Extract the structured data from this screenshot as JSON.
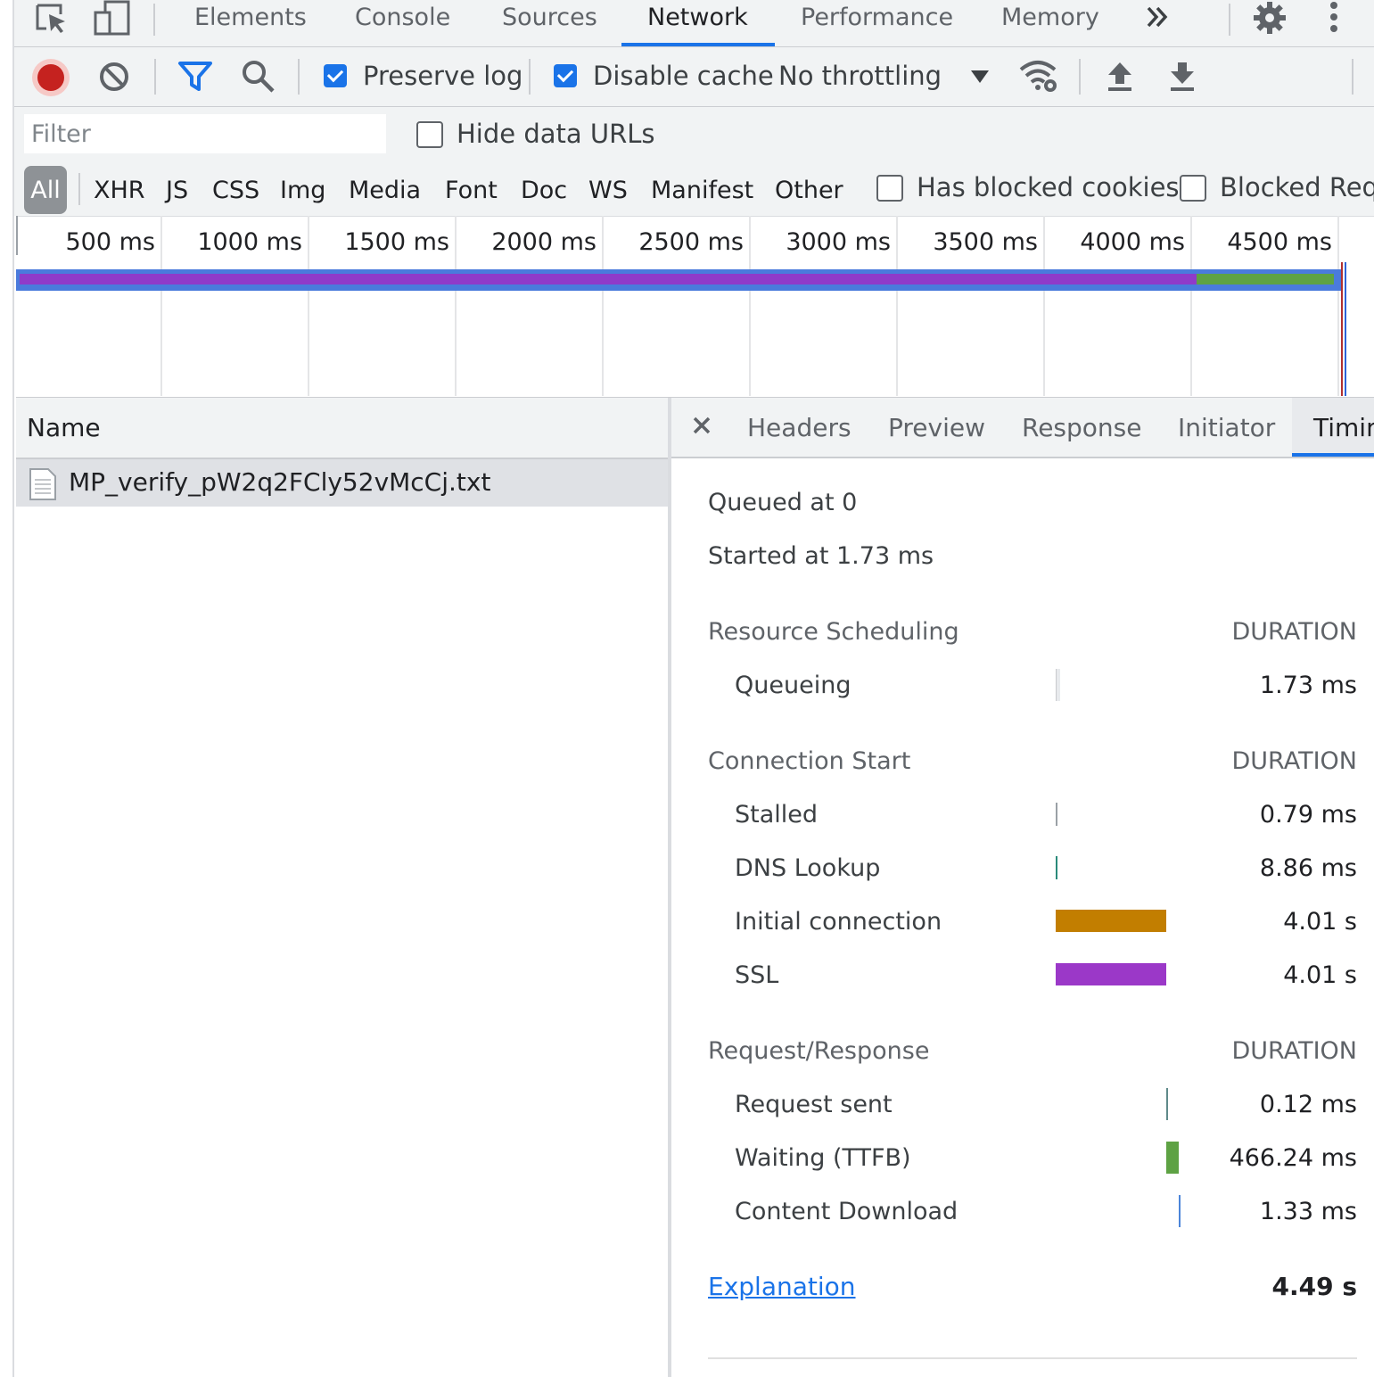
{
  "tabs": {
    "items": [
      "Elements",
      "Console",
      "Sources",
      "Network",
      "Performance",
      "Memory"
    ],
    "active": "Network"
  },
  "toolbar": {
    "preserve_log": {
      "label": "Preserve log",
      "checked": true
    },
    "disable_cache": {
      "label": "Disable cache",
      "checked": true
    },
    "throttling": "No throttling"
  },
  "filter": {
    "placeholder": "Filter",
    "hide_data_urls": "Hide data URLs",
    "types": [
      "All",
      "XHR",
      "JS",
      "CSS",
      "Img",
      "Media",
      "Font",
      "Doc",
      "WS",
      "Manifest",
      "Other"
    ],
    "has_blocked_cookies": "Has blocked cookies",
    "blocked_requests": "Blocked Requ"
  },
  "overview": {
    "ticks": [
      "500 ms",
      "1000 ms",
      "1500 ms",
      "2000 ms",
      "2500 ms",
      "3000 ms",
      "3500 ms",
      "4000 ms",
      "4500 ms"
    ]
  },
  "requests": {
    "header": "Name",
    "rows": [
      {
        "name": "MP_verify_pW2q2FCly52vMcCj.txt"
      }
    ]
  },
  "detail": {
    "tabs": [
      "Headers",
      "Preview",
      "Response",
      "Initiator",
      "Timin"
    ],
    "active_tab": "Timin",
    "queued": "Queued at 0",
    "started": "Started at 1.73 ms",
    "duration_label": "DURATION",
    "sections": {
      "scheduling": {
        "title": "Resource Scheduling",
        "rows": [
          {
            "label": "Queueing",
            "value": "1.73 ms"
          }
        ]
      },
      "connection": {
        "title": "Connection Start",
        "rows": [
          {
            "label": "Stalled",
            "value": "0.79 ms"
          },
          {
            "label": "DNS Lookup",
            "value": "8.86 ms"
          },
          {
            "label": "Initial connection",
            "value": "4.01 s"
          },
          {
            "label": "SSL",
            "value": "4.01 s"
          }
        ]
      },
      "reqres": {
        "title": "Request/Response",
        "rows": [
          {
            "label": "Request sent",
            "value": "0.12 ms"
          },
          {
            "label": "Waiting (TTFB)",
            "value": "466.24 ms"
          },
          {
            "label": "Content Download",
            "value": "1.33 ms"
          }
        ]
      }
    },
    "explanation": "Explanation",
    "total": "4.49 s"
  },
  "colors": {
    "accent": "#1a73e8",
    "record": "#c5221f",
    "initial_connection": "#c27e00",
    "ssl": "#9b38c8",
    "waiting": "#5ea244",
    "download": "#4c85d9",
    "dns": "#2a8a7a",
    "overview_outline": "#4a7bdc",
    "overview_purple": "#8f3bc9",
    "overview_green": "#5ea244"
  },
  "icons": [
    "inspect-icon",
    "device-icon",
    "more-tabs-icon",
    "gear-icon",
    "kebab-icon",
    "record-icon",
    "clear-icon",
    "filter-icon",
    "search-icon",
    "dropdown-icon",
    "network-conditions-icon",
    "upload-icon",
    "download-icon",
    "close-icon",
    "file-icon"
  ]
}
